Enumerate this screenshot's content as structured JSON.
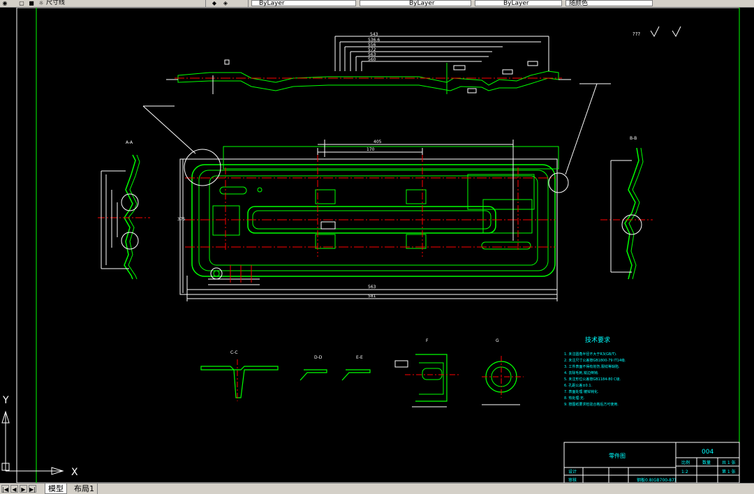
{
  "toolbar": {
    "layer_text": "尺寸线",
    "combo1": "ByLayer",
    "combo2": "ByLayer",
    "combo3": "ByLayer",
    "combo4": "随颜色"
  },
  "drawing": {
    "top_dims": [
      "543",
      "536.6",
      "556",
      "572",
      "563",
      "560"
    ],
    "title_block": {
      "name": "零件图",
      "number": "004",
      "ratio": "1:2",
      "sheet_label": "共 1 张",
      "sheet_label2": "第 1 张",
      "material": "钢板0.8(GB700-87)",
      "designer_label": "设计",
      "checker_label": "审核",
      "ratio_label": "比例",
      "qty_label": "数量",
      "weight_label": "重量"
    },
    "tech_title": "技术要求",
    "tech_notes": [
      "1. 未注圆角半径不大于R3(GB/T).",
      "2. 未注尺寸公差按GB1800-79 IT14级.",
      "3. 工件表面不得有划伤,裂纹等缺陷.",
      "4. 去除毛刺,锐边倒钝.",
      "5. 未注形位公差按GB1184-80 C级.",
      "6. 孔距公差±0.1.",
      "7. 表面处理:镀锌钝化.",
      "8. 热处理:无.",
      "9. 按图纸要求检验合格后方可使用."
    ],
    "section_labels": [
      "A-A",
      "B-B",
      "C-C",
      "D-D",
      "E-E",
      "F",
      "G"
    ],
    "bottom_dims": [
      "563",
      "581",
      "405",
      "170",
      "375",
      "149"
    ],
    "roughness": "???"
  },
  "ucs": {
    "y": "Y",
    "x": "X"
  },
  "tabs": {
    "model": "模型",
    "layout1": "布局1"
  }
}
